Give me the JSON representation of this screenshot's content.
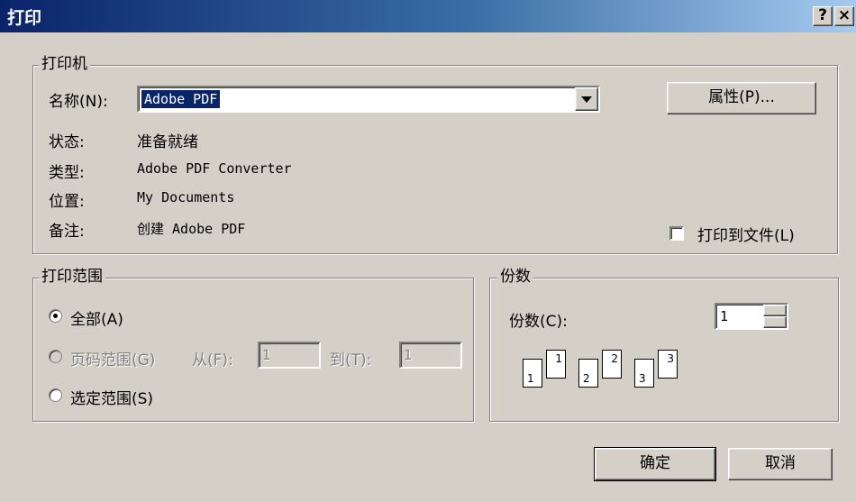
{
  "window": {
    "title": "打印",
    "help_label": "?",
    "close_label": "×"
  },
  "printer": {
    "group_label": "打印机",
    "name_label": "名称(N):",
    "name_value": "Adobe PDF",
    "properties_label": "属性(P)...",
    "status_label": "状态:",
    "status_value": "准备就绪",
    "type_label": "类型:",
    "type_value": "Adobe PDF Converter",
    "location_label": "位置:",
    "location_value": "My Documents",
    "comment_label": "备注:",
    "comment_value": "创建 Adobe PDF",
    "print_to_file_label": "打印到文件(L)",
    "print_to_file_checked": false
  },
  "range": {
    "group_label": "打印范围",
    "all_label": "全部(A)",
    "pages_label": "页码范围(G)",
    "from_label": "从(F):",
    "from_value": "1",
    "to_label": "到(T):",
    "to_value": "1",
    "selection_label": "选定范围(S)",
    "selected": "all"
  },
  "copies": {
    "group_label": "份数",
    "count_label": "份数(C):",
    "count_value": "1",
    "collate_pages": [
      "1",
      "1",
      "2",
      "2",
      "3",
      "3"
    ]
  },
  "actions": {
    "ok_label": "确定",
    "cancel_label": "取消"
  }
}
